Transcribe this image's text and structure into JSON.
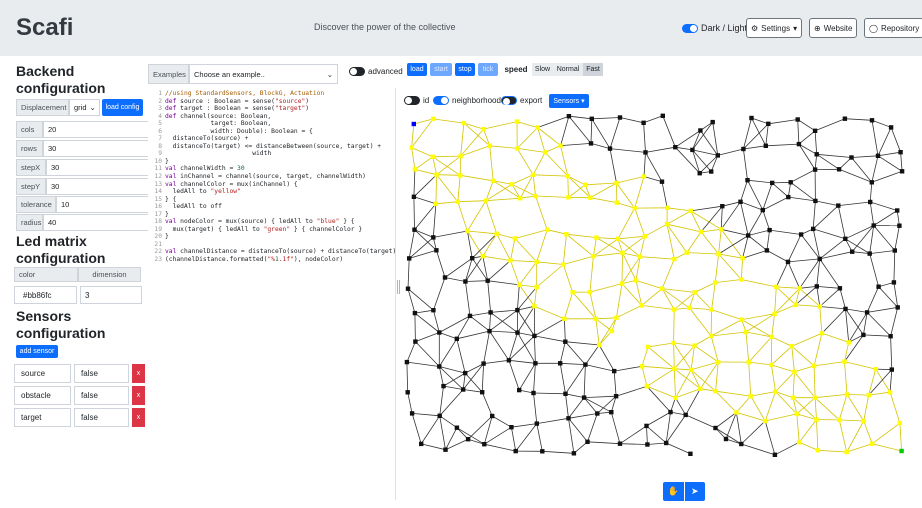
{
  "header": {
    "brand": "Scafi",
    "tagline": "Discover the power of the collective",
    "theme_label": "Dark / Light",
    "settings_label": "Settings",
    "website_label": "Website",
    "repository_label": "Repository"
  },
  "backend": {
    "title_line1": "Backend",
    "title_line2": "configuration",
    "displacement_label": "Displacement",
    "displacement_value": "grid",
    "load_config_label": "load config",
    "fields": [
      {
        "label": "cols",
        "value": "20"
      },
      {
        "label": "rows",
        "value": "30"
      },
      {
        "label": "stepX",
        "value": "30"
      },
      {
        "label": "stepY",
        "value": "30"
      },
      {
        "label": "tolerance",
        "value": "10"
      },
      {
        "label": "radius",
        "value": "40"
      }
    ]
  },
  "led": {
    "title_line1": "Led matrix",
    "title_line2": "configuration",
    "col_color": "color",
    "col_dimension": "dimension",
    "color_value": "#bb86fc",
    "dimension_value": "3"
  },
  "sensors": {
    "title_line1": "Sensors",
    "title_line2": "configuration",
    "add_label": "add sensor",
    "remove_label": "x",
    "items": [
      {
        "name": "source",
        "value": "false"
      },
      {
        "name": "obstacle",
        "value": "false"
      },
      {
        "name": "target",
        "value": "false"
      }
    ]
  },
  "examples": {
    "label": "Examples",
    "placeholder": "Choose an example..",
    "advanced_label": "advanced"
  },
  "controls": {
    "load": "load",
    "start": "start",
    "stop": "stop",
    "tick": "tick",
    "speed_label": "speed",
    "slow": "Slow",
    "normal": "Normal",
    "fast": "Fast",
    "id_label": "id",
    "neighborhood_label": "neighborhood",
    "export_label": "export",
    "sensors_dropdown": "Sensors"
  },
  "code_lines": [
    "//using StandardSensors, BlockG, Actuation",
    "def source : Boolean = sense(\"source\")",
    "def target : Boolean = sense(\"target\")",
    "def channel(source: Boolean,",
    "            target: Boolean,",
    "            width: Double): Boolean = {",
    "  distanceTo(source) +",
    "  distanceTo(target) <= distanceBetween(source, target) +",
    "                       width",
    "}",
    "val channelWidth = 30",
    "val inChannel = channel(source, target, channelWidth)",
    "val channelColor = mux(inChannel) {",
    "  ledAll to \"yellow\"",
    "} {",
    "  ledAll to off",
    "}",
    "val nodeColor = mux(source) { ledAll to \"blue\" } {",
    "  mux(target) { ledAll to \"green\" } { channelColor }",
    "}",
    "",
    "val channelDistance = distanceTo(source) + distanceTo(target)",
    "(channelDistance.formatted(\"%1.1f\"), nodeColor)"
  ],
  "colors": {
    "accent": "#0d6efd",
    "danger": "#dc3545",
    "node": "#111111",
    "channel_node": "#ffff00",
    "source_node": "#0000ff",
    "target_node": "#00cc00",
    "edge": "#333333",
    "channel_edge": "#d4c400"
  },
  "simulation": {
    "cols": 20,
    "rows": 30,
    "source": "top-left",
    "target": "bottom-right",
    "channel_width": 30
  }
}
